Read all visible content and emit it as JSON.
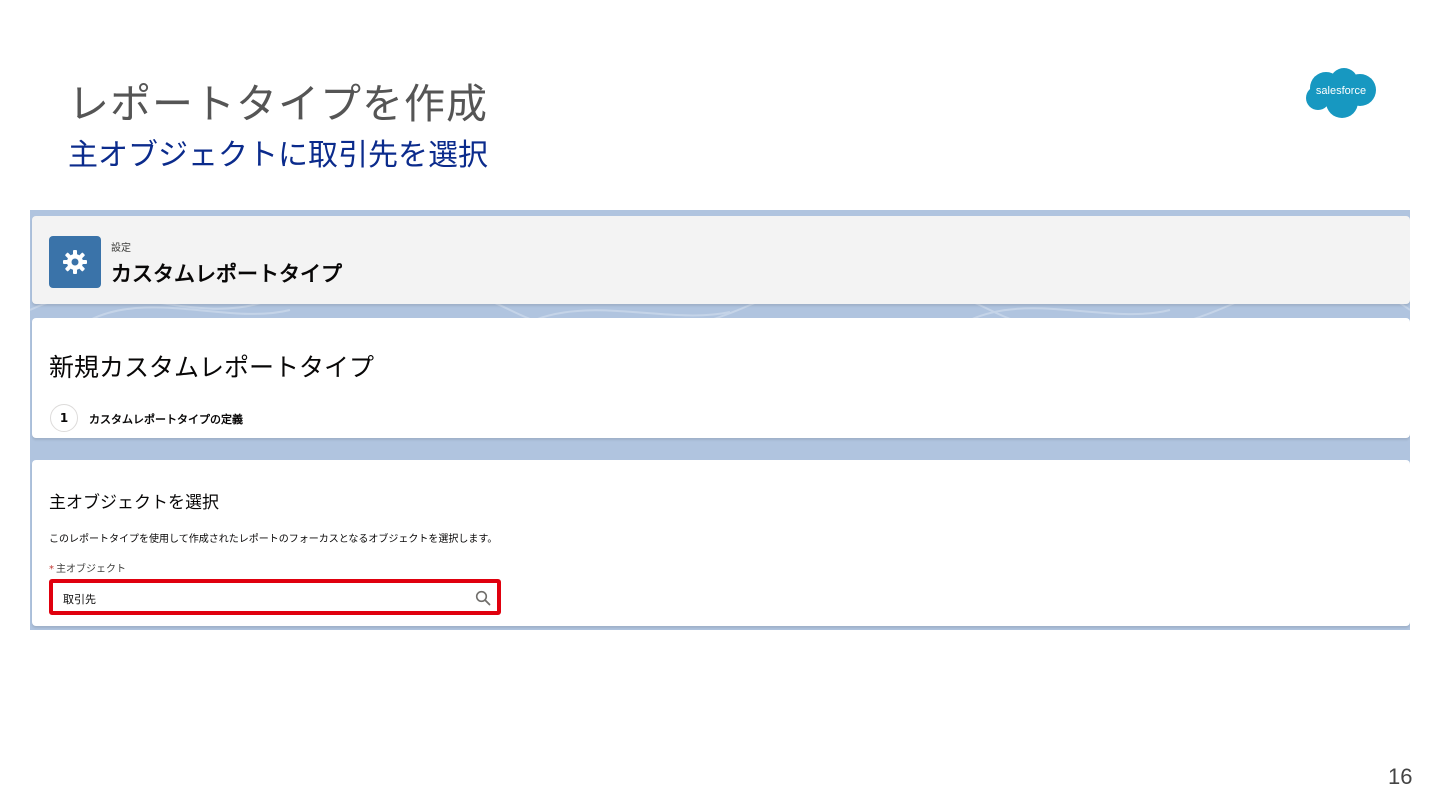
{
  "slide": {
    "title": "レポートタイプを作成",
    "subtitle": "主オブジェクトに取引先を選択",
    "page_number": "16",
    "logo_text": "salesforce"
  },
  "header": {
    "eyebrow": "設定",
    "title": "カスタムレポートタイプ",
    "icon": "gear-icon"
  },
  "wizard": {
    "title": "新規カスタムレポートタイプ",
    "step_number": "1",
    "step_label": "カスタムレポートタイプの定義"
  },
  "form": {
    "section_title": "主オブジェクトを選択",
    "description": "このレポートタイプを使用して作成されたレポートのフォーカスとなるオブジェクトを選択します。",
    "field_required_mark": "*",
    "field_label": "主オブジェクト",
    "field_value": "取引先",
    "search_icon": "search-icon"
  },
  "colors": {
    "header_icon_bg": "#3a73a9",
    "highlight_border": "#e0000e",
    "subtitle_color": "#0b2b8c",
    "logo_blue": "#1798c1",
    "background_band": "#b0c4df"
  }
}
